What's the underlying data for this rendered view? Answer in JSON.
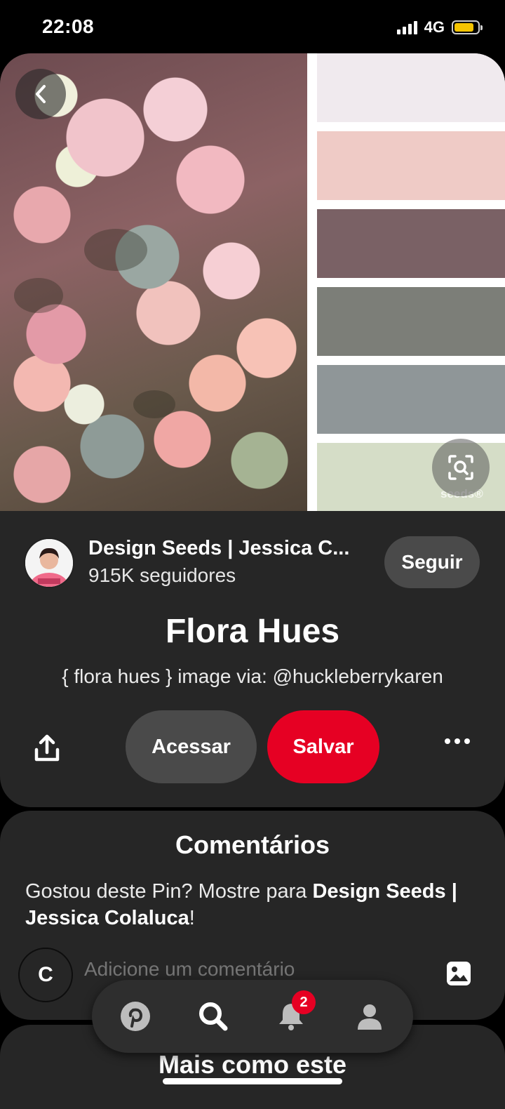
{
  "status_bar": {
    "time": "22:08",
    "network": "4G",
    "battery_color": "#f5c400",
    "battery_level": 0.85
  },
  "palette": [
    "#f0eaee",
    "#efcbc6",
    "#7a6165",
    "#7c7e78",
    "#8f9698",
    "#d5ddc7"
  ],
  "watermark": "seeds®",
  "pin": {
    "author_name": "Design Seeds | Jessica C...",
    "followers": "915K seguidores",
    "follow_label": "Seguir",
    "title": "Flora Hues",
    "description": "{ flora hues } image via: @huckleberrykaren",
    "visit_label": "Acessar",
    "save_label": "Salvar"
  },
  "comments": {
    "title": "Comentários",
    "prompt_prefix": "Gostou deste Pin? Mostre para ",
    "prompt_name": "Design Seeds | Jessica Colaluca",
    "prompt_suffix": "!",
    "avatar_initial": "C",
    "input_placeholder": "Adicione um comentário"
  },
  "more_like_this": "Mais como este",
  "nav": {
    "items": [
      "pinterest-home-icon",
      "search-icon",
      "notifications-bell-icon",
      "profile-icon"
    ],
    "notification_count": "2"
  },
  "accent_color": "#e60023"
}
